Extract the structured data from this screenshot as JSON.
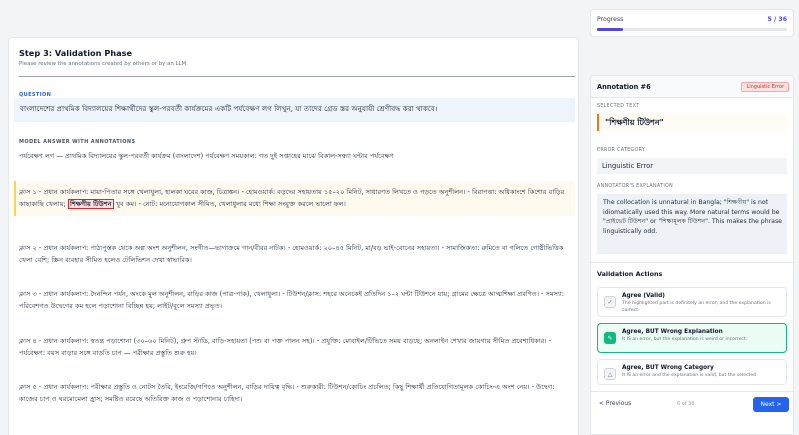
{
  "step": {
    "title": "Step 3: Validation Phase",
    "subtitle": "Please review the annotations created by others or by an LLM."
  },
  "question": {
    "label": "QUESTION",
    "text": "বাংলাদেশের প্রাথমিক বিদ্যালয়ের শিক্ষার্থীদের স্কুল-পরবর্তী কার্যক্রমের একটি পর্যবেক্ষণ লগ লিখুন, যা তাদের গ্রেড স্তর অনুযায়ী শ্রেণীবদ্ধ করা থাকবে।"
  },
  "answer": {
    "label": "MODEL ANSWER WITH ANNOTATIONS",
    "paragraphs": [
      "পর্যবেক্ষণ লগ — প্রাথমিক বিদ্যালয়ের স্কুল-পরবর্তী কার্যক্রম (বাংলাদেশ) পর্যবেক্ষণ সময়কাল: গত দুই সপ্তাহের মাঝে বিকাল-সন্ধ্যা ঘন্টার পর্যবেক্ষণ",
      "ক্লাস ২ - প্রধান কার্যকলাপ: পাঠ্যপুস্তক থেকে অল্প অংশ অনুশীলন, সংগীত—ভাগাক্রমে গান/বীরর নাটক। - হোমওয়ার্ক: ২০–৪৫ মিনিট, মা/বড় ভাই-বোনের সহায়তা। - সামাজিকতা: রুমিতে বা গলিতে গোষ্ঠীভিত্তিক খেলা বেশি; স্ক্রিন ব্যবহার সীমিত হলেও টেলিভিশন দেখা স্বাভাবিক।",
      "ক্লাস ৩ - প্রধান কার্যকলাপ: দৈনন্দিন পর্যন, অংকে মুল অনুশীলন, বাড়ির কাজ (পাত্র-পাক), খেলাধুলা। - টিউশন/ক্লাস: শহরে অনেকেই প্রতিদিন ১–২ ঘন্টা টিউশনে যায়; গ্রামের ক্ষেত্রে আত্মশিক্ষা প্রবণিত। - সমস্যা: পরিবেশগত উদ্বেগের কম হলে পড়াশোনা বিচ্ছিন্ন হয়; লাইট/বুলে সমস্যা প্রভৃত।",
      "ক্লাস ৪ - প্রধান কার্যকলাপ: স্বতন্ত্র পড়াশোনা (৩০–৬০ মিনিট), গ্রুপ স্টাডি, বাড়ি-সহায়তা (পশু বা পক্ত পালন সহ)। - প্রযুক্তি: মোবাইল/টিভিতে সময় বাড়ছে; অনলাইন শেখার জায়গায় সীমিত প্রবেশাধিকার। - পর্যবেক্ষণ: বয়স বাড়ার সঙ্গে বাড়তি চাপ — পরীক্ষার প্রস্তুতি শুরু হয়।",
      "ক্লাস ৫ - প্রধান কার্যকলাপ: পরীক্ষার প্রস্তুতি ও নোটস তৈরি, ইংরেজি/গণিতে অনুশীলন, বাড়ির দায়িত্ব বৃদ্ধি। - শুরুকারী: টিউশন/কোচিং প্রচলিত; কিছু শিক্ষার্থী প্রতিযোগিতামূলক কোচিং-এ অংশ নেয়। - উদ্বেগ: কাজের চাপ ও ঘরমোমেলা হ্রাস; সমষ্টিত রয়েছে অতিরিক্ত কাজ ও পড়াশোনার চাহিদা।"
    ],
    "p1_before": "ক্লাস ১ - প্রধান কার্যকলাপ: মায়া-পিতার সঙ্গে খেলাধুলা, হালকা ঘরের কাজ, চিত্রাঙ্কন। - হোমওয়ার্ক: বড়দের সহায়তায় ১৫–২০ মিনিট, সাধারণত লিখতে ও পড়তে অনুশীলন। - বিরাপত্তা: অধিকাংশে কিশোর বাড়ির কাছাকাছি খেলায়; ",
    "p1_highlight": "শিক্ষণীয় টিউশন",
    "p1_after": " খুব কম। - নোট: মনোযোগকাল সীমিত, খেলাধুলার মধ্যে শিক্ষা সংযুক্ত করলে ভালো ফল।"
  },
  "progress": {
    "label": "Progress",
    "count": "5 / 36",
    "fraction": 0.139
  },
  "annotation": {
    "title": "Annotation #6",
    "badge": "Linguistic Error",
    "selected_label": "SELECTED TEXT",
    "selected_text": "\"শিক্ষণীয় টিউশন\"",
    "category_label": "ERROR CATEGORY",
    "category": "Linguistic Error",
    "expl_label": "ANNOTATOR'S EXPLANATION",
    "explanation": "The collocation is unnatural in Bangla; \"শিক্ষণীয়\" is not idiomatically used this way. More natural terms would be \"প্রাইভেট টিউশন\" or \"শিক্ষামূলক টিউশন\". This makes the phrase linguistically odd."
  },
  "validation": {
    "title": "Validation Actions",
    "options": [
      {
        "title": "Agree (Valid)",
        "desc": "The highlighted part is definitely an error, and the explanation is correct."
      },
      {
        "title": "Agree, BUT Wrong Explanation",
        "desc": "It IS an error, but the explanation is weird or incorrect."
      },
      {
        "title": "Agree, BUT Wrong Category",
        "desc": "It IS an error and the explanation is valid, but the selected"
      }
    ]
  },
  "nav": {
    "prev": "< Previous",
    "page": "6 of 36",
    "next": "Next >"
  },
  "colors": {
    "accent": "#4f46e5",
    "primary": "#2563eb",
    "error": "#dc2626",
    "success": "#10b981"
  }
}
